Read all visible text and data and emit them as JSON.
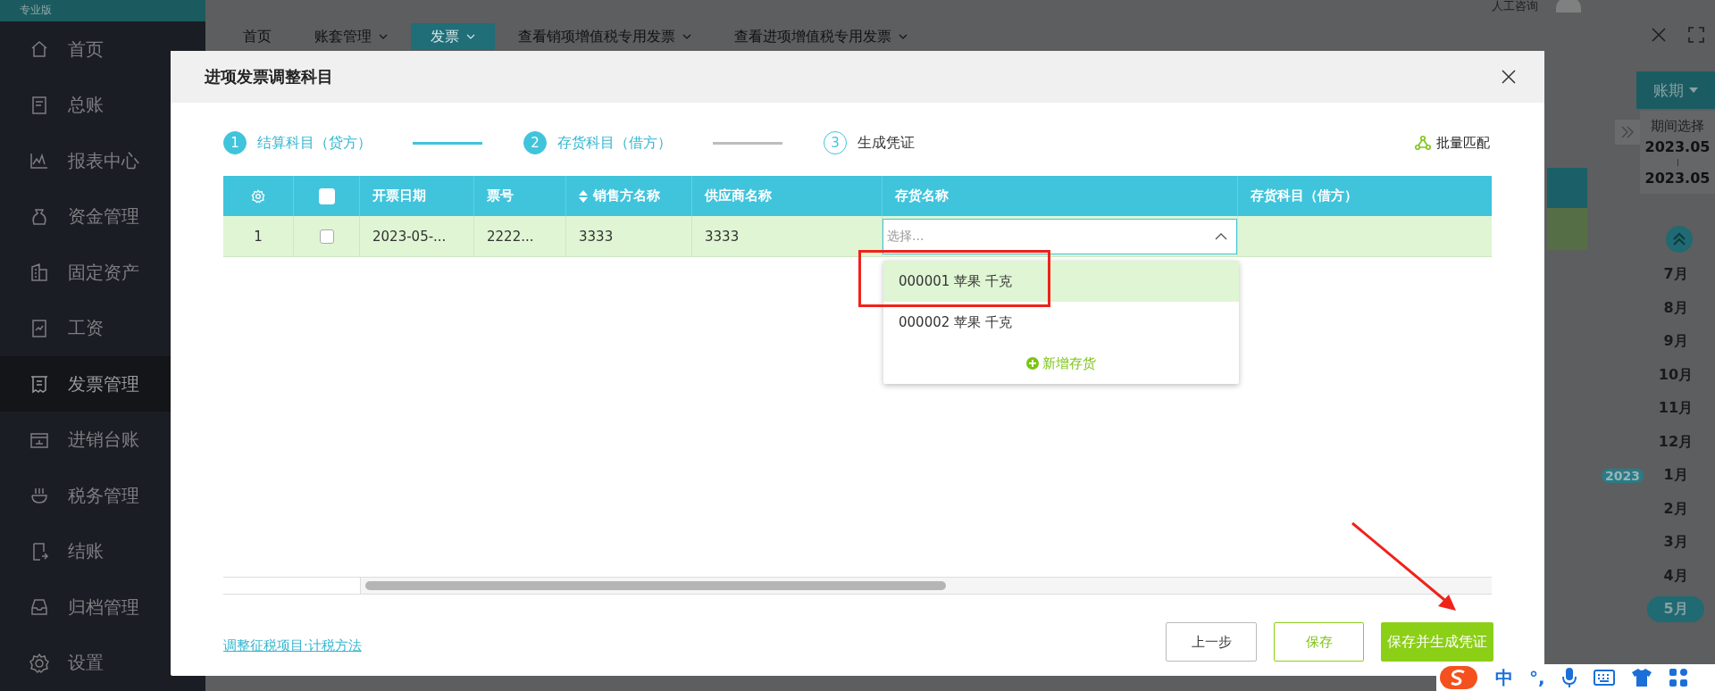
{
  "app": {
    "edition": "专业版"
  },
  "header": {
    "consult": "人工咨询"
  },
  "sidebar": {
    "items": [
      {
        "label": "首页",
        "selected": false
      },
      {
        "label": "总账",
        "selected": false
      },
      {
        "label": "报表中心",
        "selected": false
      },
      {
        "label": "资金管理",
        "selected": false
      },
      {
        "label": "固定资产",
        "selected": false
      },
      {
        "label": "工资",
        "selected": false
      },
      {
        "label": "发票管理",
        "selected": true
      },
      {
        "label": "进销台账",
        "selected": false
      },
      {
        "label": "税务管理",
        "selected": false
      },
      {
        "label": "结账",
        "selected": false
      },
      {
        "label": "归档管理",
        "selected": false
      },
      {
        "label": "设置",
        "selected": false
      }
    ]
  },
  "tabs": [
    {
      "label": "首页",
      "closable": false,
      "selected": false
    },
    {
      "label": "账套管理",
      "closable": true,
      "selected": false
    },
    {
      "label": "发票",
      "closable": true,
      "selected": true
    },
    {
      "label": "查看销项增值税专用发票",
      "closable": true,
      "selected": false
    },
    {
      "label": "查看进项增值税专用发票",
      "closable": true,
      "selected": false
    }
  ],
  "period_panel": {
    "button": "账期",
    "title": "期间选择",
    "start": "2023.05",
    "end": "2023.05",
    "year": "2023",
    "months": [
      {
        "label": "7月",
        "selected": false
      },
      {
        "label": "8月",
        "selected": false
      },
      {
        "label": "9月",
        "selected": false
      },
      {
        "label": "10月",
        "selected": false
      },
      {
        "label": "11月",
        "selected": false
      },
      {
        "label": "12月",
        "selected": false
      },
      {
        "label": "1月",
        "selected": false
      },
      {
        "label": "2月",
        "selected": false
      },
      {
        "label": "3月",
        "selected": false
      },
      {
        "label": "4月",
        "selected": false
      },
      {
        "label": "5月",
        "selected": true
      }
    ]
  },
  "dialog": {
    "title": "进项发票调整科目",
    "steps": [
      {
        "number": "1",
        "label": "结算科目（贷方）",
        "active": true
      },
      {
        "number": "2",
        "label": "存货科目（借方）",
        "active": true
      },
      {
        "number": "3",
        "label": "生成凭证",
        "active": false
      }
    ],
    "batch_match": "批量匹配",
    "table": {
      "all_checked": false,
      "columns": [
        {
          "label": "开票日期",
          "sortable": false
        },
        {
          "label": "票号",
          "sortable": false
        },
        {
          "label": "销售方名称",
          "sortable": true
        },
        {
          "label": "供应商名称",
          "sortable": false
        },
        {
          "label": "存货名称",
          "sortable": false
        },
        {
          "label": "存货科目（借方）",
          "sortable": false
        }
      ],
      "rows": [
        {
          "index": "1",
          "checked": false,
          "date": "2023-05-...",
          "number": "2222...",
          "seller": "3333",
          "supplier": "3333",
          "inventory": {
            "placeholder": "选择...",
            "expanded": true
          }
        }
      ]
    },
    "dropdown": {
      "options": [
        {
          "label": "000001 苹果 千克",
          "selected": true
        },
        {
          "label": "000002 苹果 千克",
          "selected": false
        }
      ],
      "add": "新增存货"
    },
    "link": "调整征税项目·计税方法",
    "buttons": [
      {
        "label": "上一步",
        "kind": "default"
      },
      {
        "label": "保存",
        "kind": "outline"
      },
      {
        "label": "保存并生成凭证",
        "kind": "primary"
      }
    ]
  },
  "ime": {
    "mode": "中",
    "punct": "°,"
  }
}
